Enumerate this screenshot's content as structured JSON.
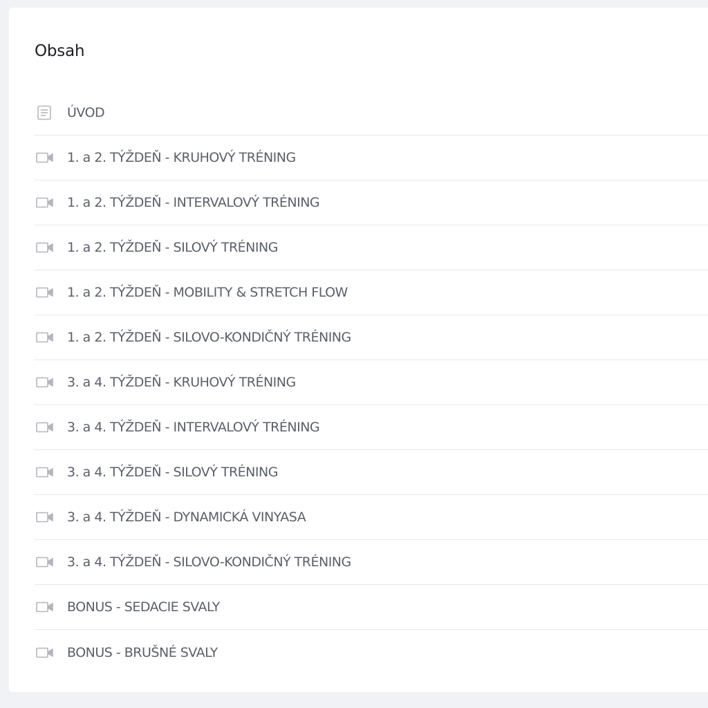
{
  "content": {
    "title": "Obsah",
    "items": [
      {
        "label": "ÚVOD",
        "icon": "document-icon"
      },
      {
        "label": "1. a 2. TÝŽDEŇ - KRUHOVÝ TRÉNING",
        "icon": "video-camera-icon"
      },
      {
        "label": "1. a 2. TÝŽDEŇ - INTERVALOVÝ TRÉNING",
        "icon": "video-camera-icon"
      },
      {
        "label": "1. a 2. TÝŽDEŇ - SILOVÝ TRÉNING",
        "icon": "video-camera-icon"
      },
      {
        "label": "1. a 2. TÝŽDEŇ - MOBILITY & STRETCH FLOW",
        "icon": "video-camera-icon"
      },
      {
        "label": "1. a 2. TÝŽDEŇ - SILOVO-KONDIČNÝ TRÉNING",
        "icon": "video-camera-icon"
      },
      {
        "label": "3. a 4. TÝŽDEŇ - KRUHOVÝ TRÉNING",
        "icon": "video-camera-icon"
      },
      {
        "label": "3. a 4. TÝŽDEŇ - INTERVALOVÝ TRÉNING",
        "icon": "video-camera-icon"
      },
      {
        "label": "3. a 4. TÝŽDEŇ - SILOVÝ TRÉNING",
        "icon": "video-camera-icon"
      },
      {
        "label": "3. a 4. TÝŽDEŇ - DYNAMICKÁ VINYASA",
        "icon": "video-camera-icon"
      },
      {
        "label": "3. a 4. TÝŽDEŇ - SILOVO-KONDIČNÝ TRÉNING",
        "icon": "video-camera-icon"
      },
      {
        "label": "BONUS - SEDACIE SVALY",
        "icon": "video-camera-icon"
      },
      {
        "label": "BONUS - BRUŠNÉ SVALY",
        "icon": "video-camera-icon"
      }
    ]
  },
  "colors": {
    "page_background": "#f1f2f5",
    "card_background": "#ffffff",
    "title_text": "#1f1f24",
    "item_text": "#5b5f6a",
    "icon": "#b4b6bd",
    "divider": "#e7e8ec"
  }
}
